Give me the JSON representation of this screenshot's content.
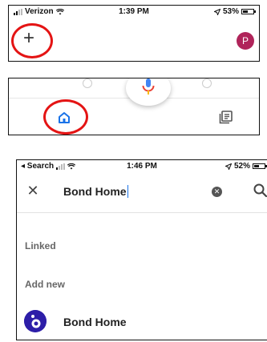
{
  "panel1": {
    "status": {
      "carrier": "Verizon",
      "time": "1:39 PM",
      "battery": "53%",
      "battery_level": 0.53
    },
    "add_label": "+",
    "avatar_initial": "P"
  },
  "panel3": {
    "status": {
      "back_label": "◂ Search",
      "time": "1:46 PM",
      "battery": "52%",
      "battery_level": 0.52
    },
    "close_label": "✕",
    "search": {
      "value": "Bond Home",
      "clear_label": "✕"
    },
    "sections": {
      "linked": "Linked",
      "add_new": "Add new"
    },
    "result": {
      "name": "Bond Home"
    }
  },
  "colors": {
    "annotation_red": "#e41414",
    "avatar": "#b0245a",
    "bond_brand": "#2d1ea8",
    "home_blue": "#1a73e8"
  },
  "icons": [
    "wifi-icon",
    "location-arrow-icon",
    "battery-icon",
    "plus-icon",
    "mic-icon",
    "home-icon",
    "list-icon",
    "close-icon",
    "clear-icon",
    "search-icon",
    "bond-logo-icon"
  ]
}
